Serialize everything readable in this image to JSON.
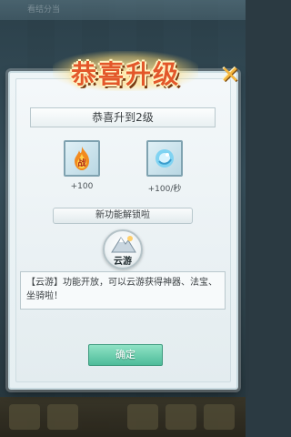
{
  "background": {
    "top_text": "看结分当"
  },
  "dialog": {
    "title": "恭喜升级",
    "close_label": "✕",
    "level_text": "恭喜升到2级",
    "rewards": [
      {
        "icon": "battle-power-flame-icon",
        "value": "+100"
      },
      {
        "icon": "spirit-orb-icon",
        "value": "+100/秒"
      }
    ],
    "feature_unlock_text": "新功能解锁啦",
    "feature": {
      "icon": "cloud-travel-icon",
      "name": "云游"
    },
    "description": "【云游】功能开放，可以云游获得神器、法宝、坐骑啦！",
    "confirm_label": "确定"
  },
  "colors": {
    "title": "#e3572a",
    "close": "#f4b53c",
    "confirm": "#4ebc9a"
  }
}
